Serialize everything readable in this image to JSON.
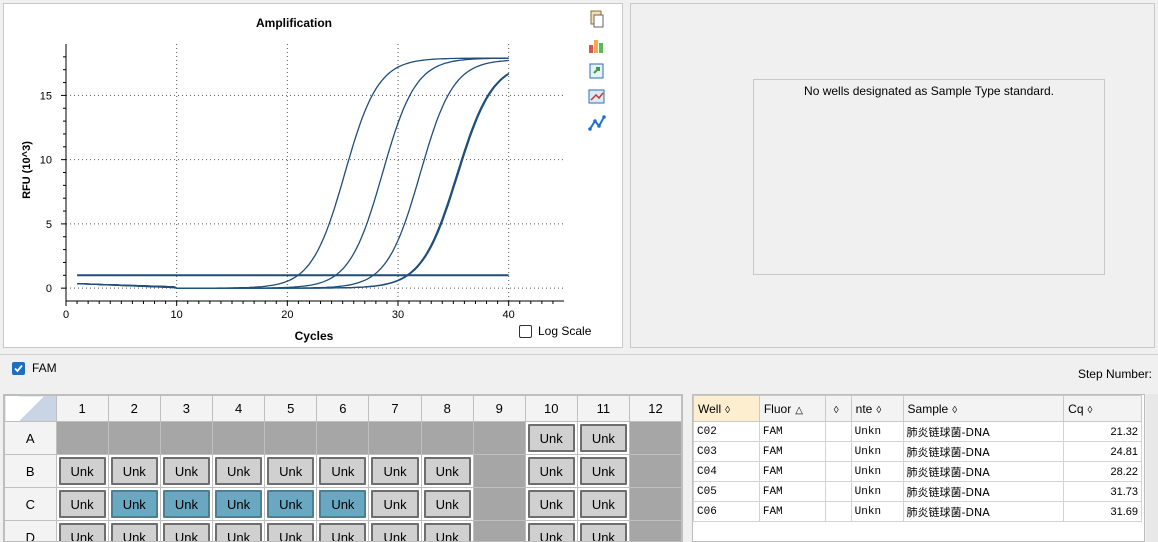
{
  "chart": {
    "title": "Amplification",
    "xlabel": "Cycles",
    "ylabel": "RFU (10^3)",
    "log_scale_label": "Log Scale",
    "log_scale_checked": false
  },
  "chart_data": {
    "type": "line",
    "title": "Amplification",
    "xlabel": "Cycles",
    "ylabel": "RFU (10^3)",
    "xlim": [
      0,
      45
    ],
    "ylim": [
      -1,
      19
    ],
    "x_ticks": [
      0,
      10,
      20,
      30,
      40
    ],
    "y_ticks": [
      0,
      5,
      10,
      15
    ],
    "grid": "dotted",
    "threshold": 1.0,
    "curves": [
      {
        "well": "C02",
        "cq": 21.32,
        "midpoint": 25.2,
        "slope": 1.5,
        "max": 17.9
      },
      {
        "well": "C03",
        "cq": 24.81,
        "midpoint": 28.6,
        "slope": 1.5,
        "max": 17.9
      },
      {
        "well": "C04",
        "cq": 28.22,
        "midpoint": 32.0,
        "slope": 1.5,
        "max": 17.8
      },
      {
        "well": "C05",
        "cq": 31.73,
        "midpoint": 35.4,
        "slope": 1.6,
        "max": 17.6
      },
      {
        "well": "C06",
        "cq": 31.69,
        "midpoint": 35.3,
        "slope": 1.6,
        "max": 17.6
      }
    ]
  },
  "standard_panel": {
    "message": "No wells designated as Sample Type standard."
  },
  "fluor_bar": {
    "fam_label": "FAM",
    "fam_checked": true,
    "step_label": "Step Number:"
  },
  "plate": {
    "columns": [
      "1",
      "2",
      "3",
      "4",
      "5",
      "6",
      "7",
      "8",
      "9",
      "10",
      "11",
      "12"
    ],
    "rows": [
      {
        "label": "A",
        "cells": [
          "",
          "",
          "",
          "",
          "",
          "",
          "",
          "",
          "",
          "Unk",
          "Unk",
          ""
        ],
        "selected": []
      },
      {
        "label": "B",
        "cells": [
          "Unk",
          "Unk",
          "Unk",
          "Unk",
          "Unk",
          "Unk",
          "Unk",
          "Unk",
          "",
          "Unk",
          "Unk",
          ""
        ],
        "selected": []
      },
      {
        "label": "C",
        "cells": [
          "Unk",
          "Unk",
          "Unk",
          "Unk",
          "Unk",
          "Unk",
          "Unk",
          "Unk",
          "",
          "Unk",
          "Unk",
          ""
        ],
        "selected": [
          1,
          2,
          3,
          4,
          5
        ]
      },
      {
        "label": "D",
        "cells": [
          "Unk",
          "Unk",
          "Unk",
          "Unk",
          "Unk",
          "Unk",
          "Unk",
          "Unk",
          "",
          "Unk",
          "Unk",
          ""
        ],
        "selected": []
      }
    ]
  },
  "sheet": {
    "headers": [
      {
        "key": "well",
        "label": "Well",
        "icon": "◊",
        "sorted": true
      },
      {
        "key": "fluor",
        "label": "Fluor",
        "icon": "△",
        "sorted": false
      },
      {
        "key": "target",
        "label": "",
        "icon": "◊",
        "sorted": false
      },
      {
        "key": "content",
        "label": "nte",
        "icon": "◊",
        "sorted": false
      },
      {
        "key": "sample",
        "label": "Sample",
        "icon": "◊",
        "sorted": false
      },
      {
        "key": "cq",
        "label": "Cq",
        "icon": "◊",
        "sorted": false
      }
    ],
    "rows": [
      {
        "well": "C02",
        "fluor": "FAM",
        "target": "",
        "content": "Unkn",
        "sample": "肺炎链球菌-DNA",
        "cq": "21.32"
      },
      {
        "well": "C03",
        "fluor": "FAM",
        "target": "",
        "content": "Unkn",
        "sample": "肺炎链球菌-DNA",
        "cq": "24.81"
      },
      {
        "well": "C04",
        "fluor": "FAM",
        "target": "",
        "content": "Unkn",
        "sample": "肺炎链球菌-DNA",
        "cq": "28.22"
      },
      {
        "well": "C05",
        "fluor": "FAM",
        "target": "",
        "content": "Unkn",
        "sample": "肺炎链球菌-DNA",
        "cq": "31.73"
      },
      {
        "well": "C06",
        "fluor": "FAM",
        "target": "",
        "content": "Unkn",
        "sample": "肺炎链球菌-DNA",
        "cq": "31.69"
      }
    ]
  },
  "toolbar": {
    "icons": [
      "copy-icon",
      "chart-settings-icon",
      "export-icon",
      "zoom-icon",
      "trace-style-icon"
    ]
  },
  "colors": {
    "curve": "#1f4e79",
    "threshold": "#1f4e79",
    "selected_well": "#6aa7c0",
    "accent": "#1b6ec2"
  }
}
